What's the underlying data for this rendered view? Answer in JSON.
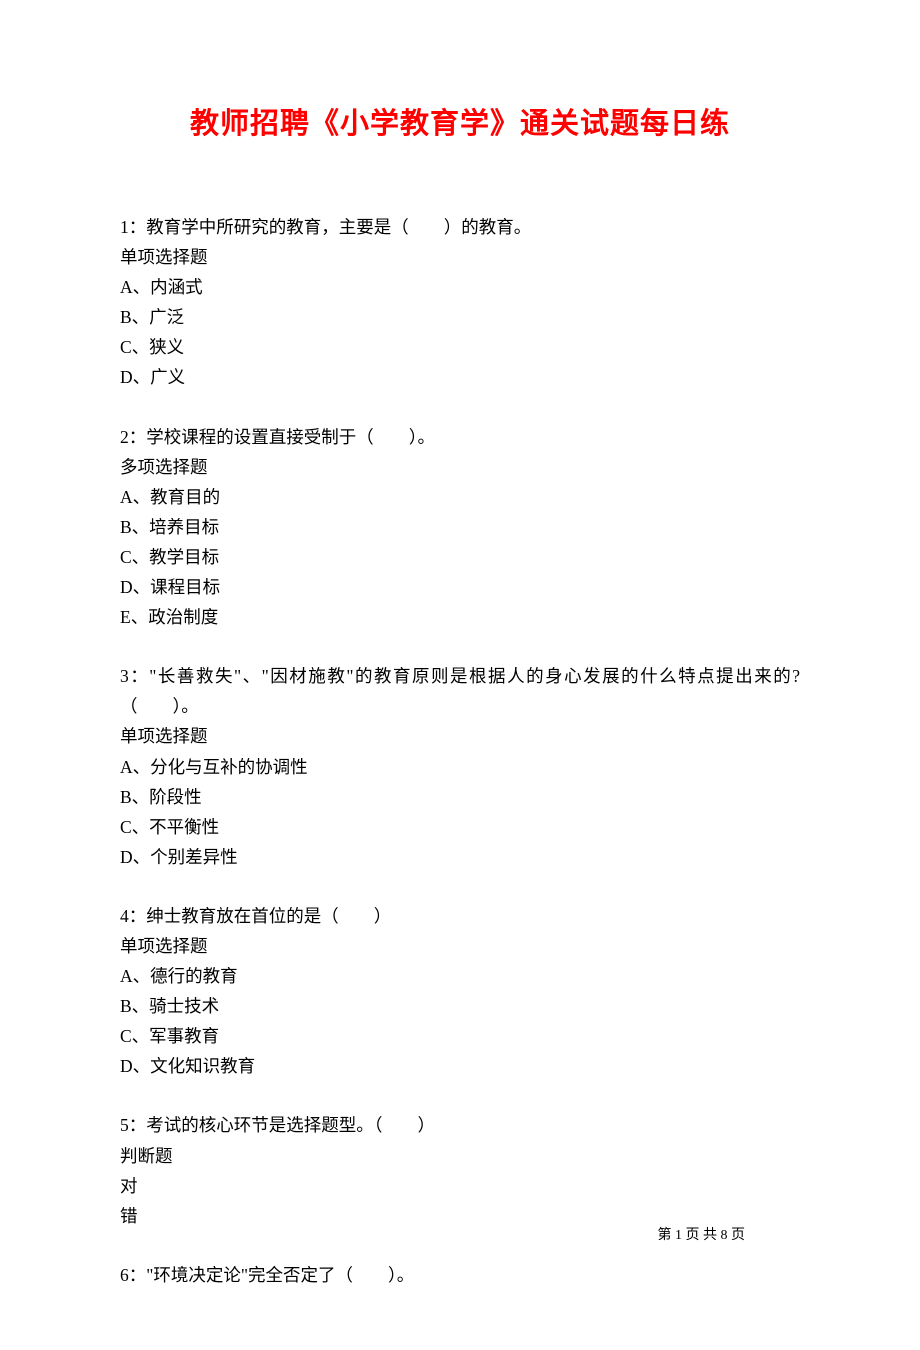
{
  "title": "教师招聘《小学教育学》通关试题每日练",
  "questions": [
    {
      "text": "1：教育学中所研究的教育，主要是（　　）的教育。",
      "type": "单项选择题",
      "options": [
        "A、内涵式",
        "B、广泛",
        "C、狭义",
        "D、广义"
      ]
    },
    {
      "text": " 2：学校课程的设置直接受制于（　　）。",
      "type": "多项选择题",
      "options": [
        "A、教育目的",
        "B、培养目标",
        "C、教学目标",
        "D、课程目标",
        "E、政治制度"
      ]
    },
    {
      "text": " 3：\"长善救失\"、\"因材施教\"的教育原则是根据人的身心发展的什么特点提出来的?（　　）。",
      "type": "单项选择题",
      "options": [
        "A、分化与互补的协调性",
        "B、阶段性",
        "C、不平衡性",
        "D、个别差异性"
      ]
    },
    {
      "text": " 4：绅士教育放在首位的是（　　）",
      "type": "单项选择题",
      "options": [
        "A、德行的教育",
        "B、骑士技术",
        "C、军事教育",
        "D、文化知识教育"
      ]
    },
    {
      "text": " 5：考试的核心环节是选择题型。（　　）",
      "type": "判断题",
      "options": [
        "对",
        "错"
      ]
    },
    {
      "text": " 6：\"环境决定论\"完全否定了（　　）。",
      "type": "",
      "options": []
    }
  ],
  "footer": "第 1 页 共 8 页"
}
